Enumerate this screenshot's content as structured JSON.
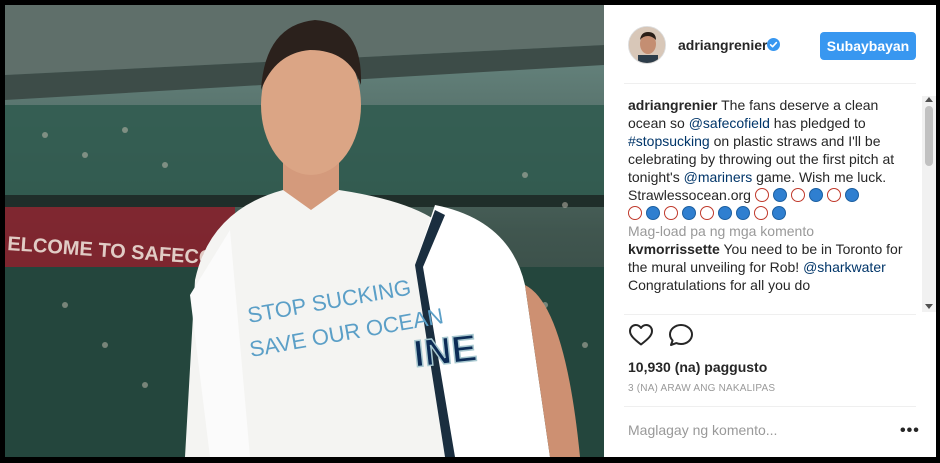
{
  "post": {
    "username": "adriangrenier",
    "follow_label": "Subaybayan",
    "verified": true,
    "shirt_line1": "STOP SUCKING",
    "shirt_line2": "SAVE OUR OCEAN",
    "jersey_text": "INE"
  },
  "caption": {
    "author": "adriangrenier",
    "text_part1": " The fans deserve a clean ocean so ",
    "mention1": "@safecofield",
    "text_part2": " has pledged to ",
    "hashtag": "#stopsucking",
    "text_part3": " on plastic straws and I'll be celebrating by throwing out the first pitch at tonight's ",
    "mention2": "@mariners",
    "text_part4": " game. Wish me luck. Strawlessocean.org "
  },
  "load_more": "Mag-load pa ng mga komento",
  "comment": {
    "author": "kvmorrissette",
    "text_part1": " You need to be in Toronto for the mural unveiling for Rob! ",
    "mention": "@sharkwater",
    "text_part2": " Congratulations for all you do"
  },
  "likes_text": "10,930 (na) paggusto",
  "time_text": "3 (NA) ARAW ANG NAKALIPAS",
  "add_comment_placeholder": "Maglagay ng komento...",
  "more_options": "•••",
  "icons": {
    "like": "heart-icon",
    "comment": "comment-bubble-icon",
    "verified": "verified-badge-icon",
    "emoji_a": "baseball-emoji",
    "emoji_b": "earth-globe-emoji"
  },
  "colors": {
    "accent": "#3897f0",
    "link": "#003569",
    "muted": "#999999",
    "text": "#262626"
  }
}
